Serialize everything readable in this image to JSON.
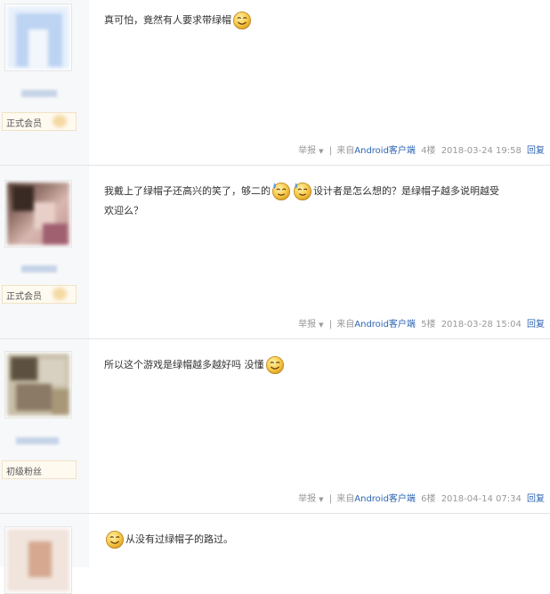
{
  "posts": [
    {
      "badge_label": "正式会员",
      "text_before": "真可怕，竟然有人要求带绿帽",
      "text_after": "",
      "tail": {
        "report": "举报",
        "sep": "|",
        "from": "来自",
        "client": "Android客户端",
        "floor": "4楼",
        "time": "2018-03-24 19:58",
        "reply": "回复"
      }
    },
    {
      "badge_label": "正式会员",
      "text_before": "我戴上了绿帽子还高兴的笑了，够二的",
      "text_after": "设计者是怎么想的？是绿帽子越多说明越受",
      "text_line2": "欢迎么？",
      "tail": {
        "report": "举报",
        "sep": "|",
        "from": "来自",
        "client": "Android客户端",
        "floor": "5楼",
        "time": "2018-03-28 15:04",
        "reply": "回复"
      }
    },
    {
      "badge_label": "初级粉丝",
      "text_before": "所以这个游戏是绿帽越多越好吗 没懂",
      "text_after": "",
      "tail": {
        "report": "举报",
        "sep": "|",
        "from": "来自",
        "client": "Android客户端",
        "floor": "6楼",
        "time": "2018-04-14 07:34",
        "reply": "回复"
      }
    },
    {
      "text_before": "",
      "text_after": "从没有过绿帽子的路过。"
    }
  ],
  "colors": {
    "link": "#2d64b3",
    "sidebar": "#f7f8fa",
    "meta": "#999999"
  },
  "icons": [
    "smile-emoji-icon",
    "sweat-emoji-icon",
    "dropdown-arrow-icon"
  ]
}
